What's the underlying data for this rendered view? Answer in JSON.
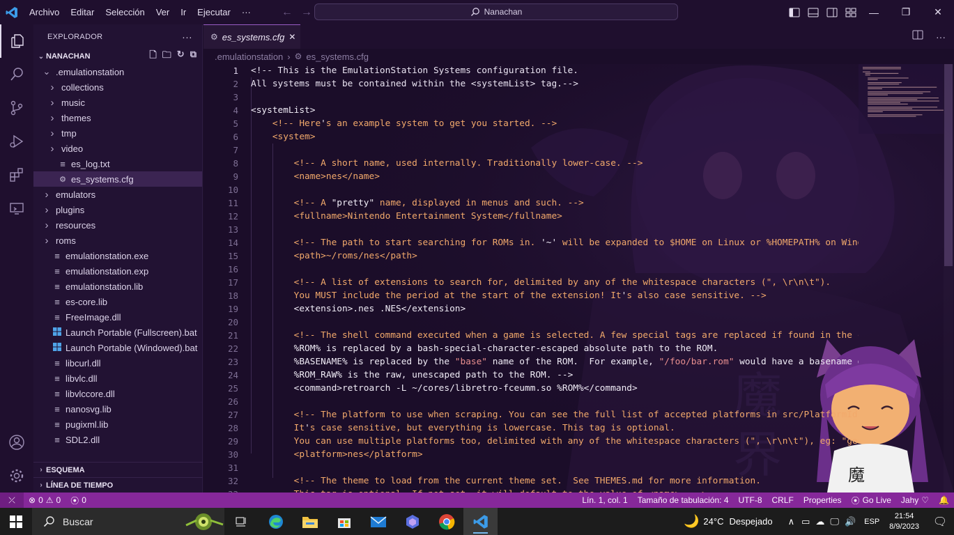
{
  "titlebar": {
    "menu": [
      "Archivo",
      "Editar",
      "Selección",
      "Ver",
      "Ir",
      "Ejecutar",
      "···"
    ],
    "command_center": "Nanachan"
  },
  "activity_icons": [
    "files-icon",
    "search-icon",
    "source-control-icon",
    "run-debug-icon",
    "extensions-icon",
    "remote-explorer-icon"
  ],
  "sidebar": {
    "title": "EXPLORADOR",
    "root": "NANACHAN",
    "tree": [
      {
        "label": ".emulationstation",
        "indent": 1,
        "type": "folder-open"
      },
      {
        "label": "collections",
        "indent": 2,
        "type": "folder"
      },
      {
        "label": "music",
        "indent": 2,
        "type": "folder"
      },
      {
        "label": "themes",
        "indent": 2,
        "type": "folder"
      },
      {
        "label": "tmp",
        "indent": 2,
        "type": "folder"
      },
      {
        "label": "video",
        "indent": 2,
        "type": "folder"
      },
      {
        "label": "es_log.txt",
        "indent": 2,
        "type": "text"
      },
      {
        "label": "es_systems.cfg",
        "indent": 2,
        "type": "gear",
        "selected": true
      },
      {
        "label": "emulators",
        "indent": 1,
        "type": "folder"
      },
      {
        "label": "plugins",
        "indent": 1,
        "type": "folder"
      },
      {
        "label": "resources",
        "indent": 1,
        "type": "folder"
      },
      {
        "label": "roms",
        "indent": 1,
        "type": "folder"
      },
      {
        "label": "emulationstation.exe",
        "indent": 1,
        "type": "text"
      },
      {
        "label": "emulationstation.exp",
        "indent": 1,
        "type": "text"
      },
      {
        "label": "emulationstation.lib",
        "indent": 1,
        "type": "text"
      },
      {
        "label": "es-core.lib",
        "indent": 1,
        "type": "text"
      },
      {
        "label": "FreeImage.dll",
        "indent": 1,
        "type": "text"
      },
      {
        "label": "Launch Portable (Fullscreen).bat",
        "indent": 1,
        "type": "windows"
      },
      {
        "label": "Launch Portable (Windowed).bat",
        "indent": 1,
        "type": "windows"
      },
      {
        "label": "libcurl.dll",
        "indent": 1,
        "type": "text"
      },
      {
        "label": "libvlc.dll",
        "indent": 1,
        "type": "text"
      },
      {
        "label": "libvlccore.dll",
        "indent": 1,
        "type": "text"
      },
      {
        "label": "nanosvg.lib",
        "indent": 1,
        "type": "text"
      },
      {
        "label": "pugixml.lib",
        "indent": 1,
        "type": "text"
      },
      {
        "label": "SDL2.dll",
        "indent": 1,
        "type": "text"
      }
    ],
    "outline": "ESQUEMA",
    "timeline": "LÍNEA DE TIEMPO"
  },
  "editor": {
    "tab": "es_systems.cfg",
    "breadcrumb": [
      ".emulationstation",
      "es_systems.cfg"
    ],
    "lines": [
      [
        [
          "cl",
          "<!-- This is the EmulationStation Systems configuration file."
        ]
      ],
      [
        [
          "cl",
          "All systems must be contained within the <systemList> tag.-->"
        ]
      ],
      [
        [
          "cl",
          ""
        ]
      ],
      [
        [
          "tg",
          "<systemList>"
        ]
      ],
      [
        [
          "sp",
          "    "
        ],
        [
          "cm",
          "<!-- Here"
        ],
        [
          "tg",
          "'"
        ],
        [
          "cm",
          "s an example system to get you started. -->"
        ]
      ],
      [
        [
          "sp",
          "    "
        ],
        [
          "cm",
          "<system>"
        ]
      ],
      [
        [
          "cl",
          ""
        ]
      ],
      [
        [
          "sp",
          "        "
        ],
        [
          "cm",
          "<!-- A short name, used internally. Traditionally lower-case. -->"
        ]
      ],
      [
        [
          "sp",
          "        "
        ],
        [
          "cm",
          "<name>nes</name>"
        ]
      ],
      [
        [
          "cl",
          ""
        ]
      ],
      [
        [
          "sp",
          "        "
        ],
        [
          "cm",
          "<!-- A "
        ],
        [
          "tg",
          "\"pretty\""
        ],
        [
          "cm",
          " name, displayed in menus and such. -->"
        ]
      ],
      [
        [
          "sp",
          "        "
        ],
        [
          "cm",
          "<fullname>Nintendo Entertainment System</fullname>"
        ]
      ],
      [
        [
          "cl",
          ""
        ]
      ],
      [
        [
          "sp",
          "        "
        ],
        [
          "cm",
          "<!-- The path to start searching for ROMs in. "
        ],
        [
          "tg",
          "'~'"
        ],
        [
          "cm",
          " will be expanded to $HOME on Linux or %HOMEPATH% on Windows."
        ]
      ],
      [
        [
          "sp",
          "        "
        ],
        [
          "cm",
          "<path>~/roms/nes</path>"
        ]
      ],
      [
        [
          "cl",
          ""
        ]
      ],
      [
        [
          "sp",
          "        "
        ],
        [
          "cm",
          "<!-- A list of extensions to search for, delimited by any of the whitespace characters (\", \\r\\n\\t\")."
        ]
      ],
      [
        [
          "sp",
          "        "
        ],
        [
          "cm",
          "You MUST include the period at the start of the extension! It"
        ],
        [
          "tg",
          "'"
        ],
        [
          "cm",
          "s also case sensitive. -->"
        ]
      ],
      [
        [
          "sp",
          "        "
        ],
        [
          "tg",
          "<extension>.nes .NES</extension>"
        ]
      ],
      [
        [
          "cl",
          ""
        ]
      ],
      [
        [
          "sp",
          "        "
        ],
        [
          "cm",
          "<!-- The shell command executed when a game is selected. A few special tags are replaced if found in the command:"
        ]
      ],
      [
        [
          "sp",
          "        "
        ],
        [
          "tg",
          "%ROM% is replaced by a bash-special-character-escaped absolute path to the ROM."
        ]
      ],
      [
        [
          "sp",
          "        "
        ],
        [
          "tg",
          "%BASENAME% is replaced by the "
        ],
        [
          "st",
          "\"base\""
        ],
        [
          "tg",
          " name of the ROM.  For example, "
        ],
        [
          "st",
          "\"/foo/bar.rom\""
        ],
        [
          "tg",
          " would have a basename of \"bar\"."
        ]
      ],
      [
        [
          "sp",
          "        "
        ],
        [
          "tg",
          "%ROM_RAW% is the raw, unescaped path to the ROM. -->"
        ]
      ],
      [
        [
          "sp",
          "        "
        ],
        [
          "tg",
          "<command>retroarch -L ~/cores/libretro-fceumm.so %ROM%</command>"
        ]
      ],
      [
        [
          "cl",
          ""
        ]
      ],
      [
        [
          "sp",
          "        "
        ],
        [
          "cm",
          "<!-- The platform to use when scraping. You can see the full list of accepted platforms in src/PlatformIds.cpp."
        ]
      ],
      [
        [
          "sp",
          "        "
        ],
        [
          "cm",
          "It"
        ],
        [
          "tg",
          "'"
        ],
        [
          "cm",
          "s case sensitive, but everything is lowercase. This tag is optional."
        ]
      ],
      [
        [
          "sp",
          "        "
        ],
        [
          "cm",
          "You can use multiple platforms too, delimited with any of the whitespace characters (\", \\r\\n\\t\"), eg: \"genesis, megadrive\" -->"
        ]
      ],
      [
        [
          "sp",
          "        "
        ],
        [
          "cm",
          "<platform>nes</platform>"
        ]
      ],
      [
        [
          "cl",
          ""
        ]
      ],
      [
        [
          "sp",
          "        "
        ],
        [
          "cm",
          "<!-- The theme to load from the current theme set.  See THEMES.md for more information."
        ]
      ],
      [
        [
          "sp",
          "        "
        ],
        [
          "cm",
          "This tag is optional. If not set, it will default to the value of <name>. -->"
        ]
      ]
    ]
  },
  "statusbar": {
    "errors": "0",
    "warnings": "0",
    "ports": "0",
    "position": "Lín. 1, col. 1",
    "tab_size": "Tamaño de tabulación: 4",
    "encoding": "UTF-8",
    "eol": "CRLF",
    "language": "Properties",
    "golive": "Go Live",
    "theme": "Jahy"
  },
  "taskbar": {
    "search": "Buscar",
    "weather_temp": "24°C",
    "weather_desc": "Despejado",
    "lang": "ESP",
    "time": "21:54",
    "date": "8/9/2023"
  },
  "colors": {
    "accent": "#86289a",
    "comment": "#f2a96b",
    "string": "#e98f8f",
    "taskbar": "#1c1c1c"
  }
}
